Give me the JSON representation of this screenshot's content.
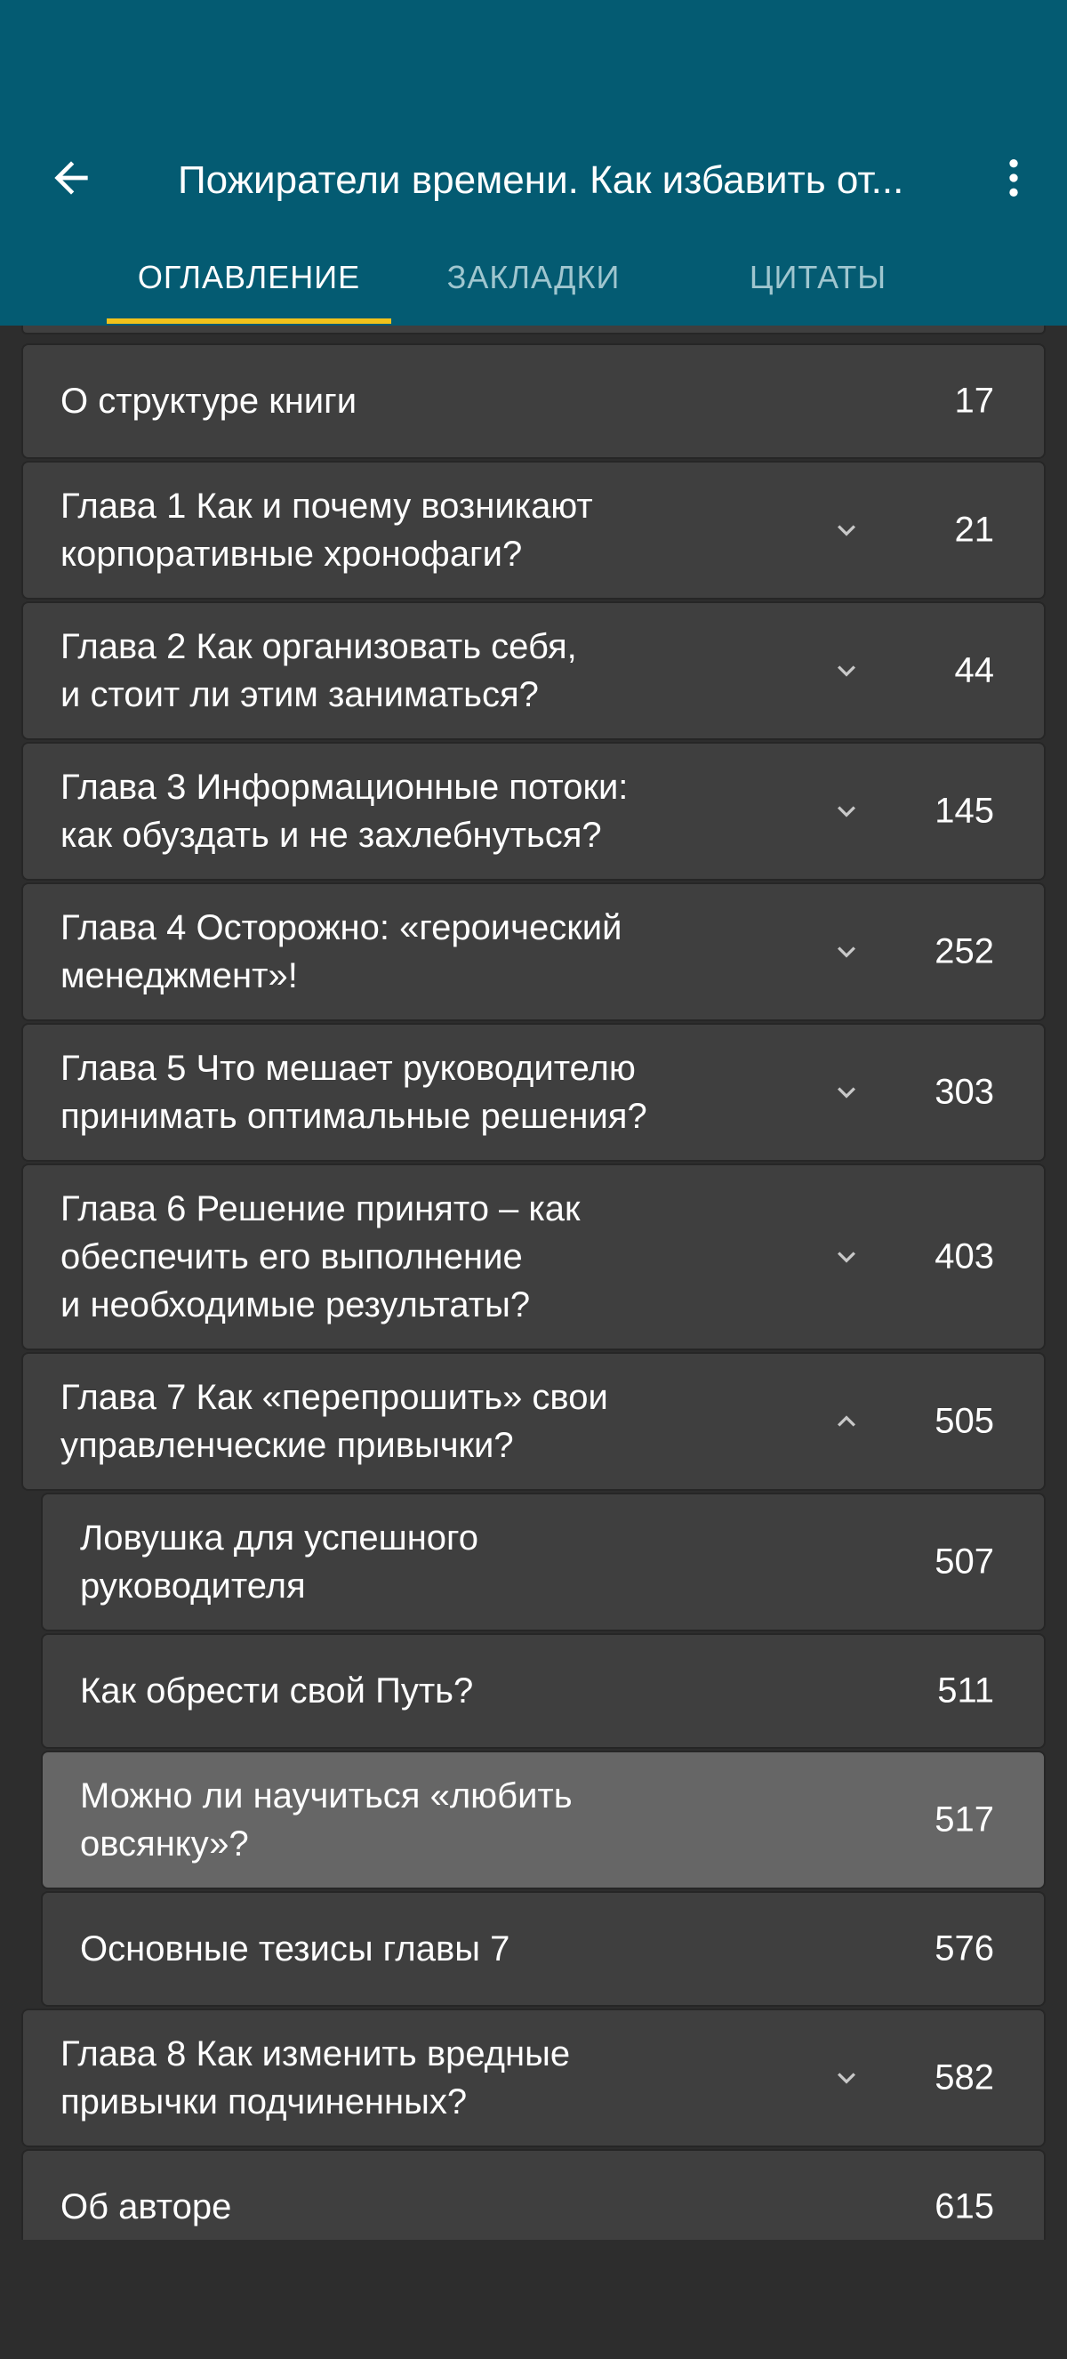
{
  "header": {
    "title": "Пожиратели времени. Как избавить от...",
    "back_icon": "arrow-left-icon",
    "menu_icon": "more-vert-icon",
    "background": "#045b72"
  },
  "tabs": [
    {
      "label": "ОГЛАВЛЕНИЕ",
      "active": true
    },
    {
      "label": "ЗАКЛАДКИ",
      "active": false
    },
    {
      "label": "ЦИТАТЫ",
      "active": false
    }
  ],
  "accent": "#f2c21b",
  "toc": {
    "items": [
      {
        "label": "О структуре книги",
        "page": "17"
      },
      {
        "label": "Глава 1 Как и почему возникают\nкорпоративные хронофаги?",
        "page": "21",
        "chevron": "chevron-down-icon"
      },
      {
        "label": "Глава 2 Как организовать себя,\nи стоит ли этим заниматься?",
        "page": "44",
        "chevron": "chevron-down-icon"
      },
      {
        "label": "Глава 3 Информационные потоки:\nкак обуздать и не захлебнуться?",
        "page": "145",
        "chevron": "chevron-down-icon"
      },
      {
        "label": "Глава 4 Осторожно: «героический\nменеджмент»!",
        "page": "252",
        "chevron": "chevron-down-icon"
      },
      {
        "label": "Глава 5 Что мешает руководителю\nпринимать оптимальные решения?",
        "page": "303",
        "chevron": "chevron-down-icon"
      },
      {
        "label": "Глава 6 Решение принято – как\nобеспечить его выполнение\nи необходимые результаты?",
        "page": "403",
        "chevron": "chevron-down-icon"
      },
      {
        "label": "Глава 7 Как «перепрошить» свои\nуправленческие привычки?",
        "page": "505",
        "chevron": "chevron-up-icon"
      },
      {
        "label": "Ловушка для успешного\nруководителя",
        "page": "507",
        "sub": true
      },
      {
        "label": "Как обрести свой Путь?",
        "page": "511",
        "sub": true
      },
      {
        "label": "Можно ли научиться «любить\nовсянку»?",
        "page": "517",
        "sub": true,
        "selected": true
      },
      {
        "label": "Основные тезисы главы 7",
        "page": "576",
        "sub": true
      },
      {
        "label": "Глава 8 Как изменить вредные\nпривычки подчиненных?",
        "page": "582",
        "chevron": "chevron-down-icon"
      },
      {
        "label": "Об авторе",
        "page": "615"
      }
    ]
  }
}
